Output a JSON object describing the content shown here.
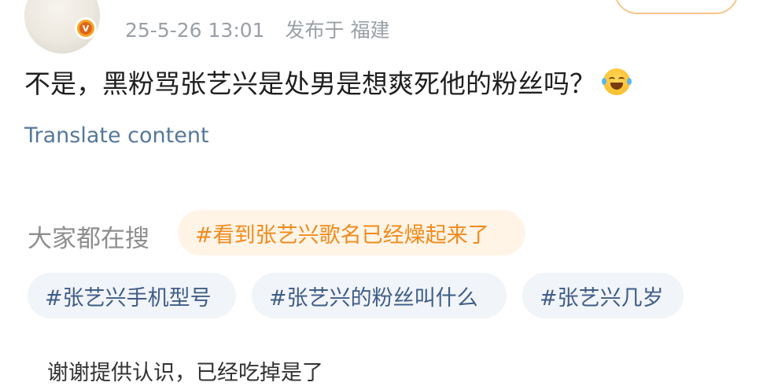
{
  "header": {
    "timestamp": "25-5-26 13:01",
    "location": "发布于 福建",
    "badge_icon": "verified-v-badge"
  },
  "post": {
    "text": "不是，黑粉骂张艺兴是处男是想爽死他的粉丝吗？",
    "emoji": "laughing-tears-emoji",
    "translate_label": "Translate content"
  },
  "hot_search": {
    "label": "大家都在搜",
    "featured": "#看到张艺兴歌名已经燥起来了",
    "items": [
      "#张艺兴手机型号",
      "#张艺兴的粉丝叫什么",
      "#张艺兴几岁"
    ]
  },
  "footer_cut": {
    "text": "谢谢提供认识，已经吃掉是了"
  },
  "colors": {
    "meta": "#9aa0a6",
    "link": "#56789a",
    "featured_chip_bg": "#fff4e6",
    "featured_chip_text": "#f08a1c",
    "chip_bg": "#f1f4f8",
    "chip_text": "#3f5d87",
    "follow_border": "#f6c58a"
  }
}
